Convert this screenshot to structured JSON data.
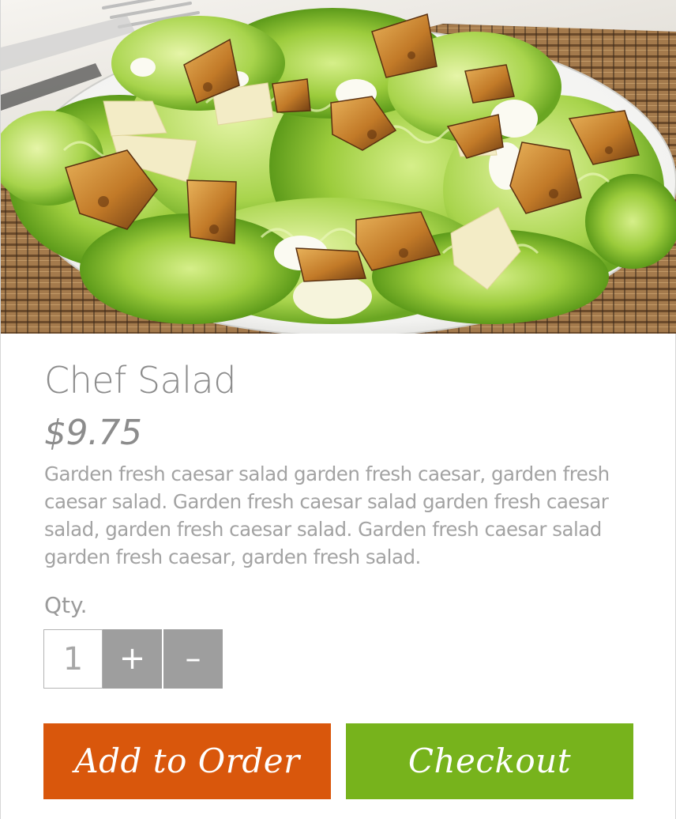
{
  "product": {
    "image_alt": "Chef Salad photo",
    "name": "Chef Salad",
    "price": "$9.75",
    "description": "Garden fresh caesar salad garden fresh caesar, garden fresh caesar salad. Garden fresh caesar salad garden fresh caesar salad, garden fresh caesar salad. Garden fresh caesar salad garden fresh caesar, garden fresh salad."
  },
  "quantity": {
    "label": "Qty.",
    "value": "1",
    "increment_label": "+",
    "decrement_label": "–"
  },
  "actions": {
    "add_to_order_label": "Add to Order",
    "checkout_label": "Checkout"
  },
  "colors": {
    "add_to_order": "#d9570c",
    "checkout": "#77b31c",
    "stepper": "#9e9e9e",
    "text": "#8c8c8c"
  }
}
